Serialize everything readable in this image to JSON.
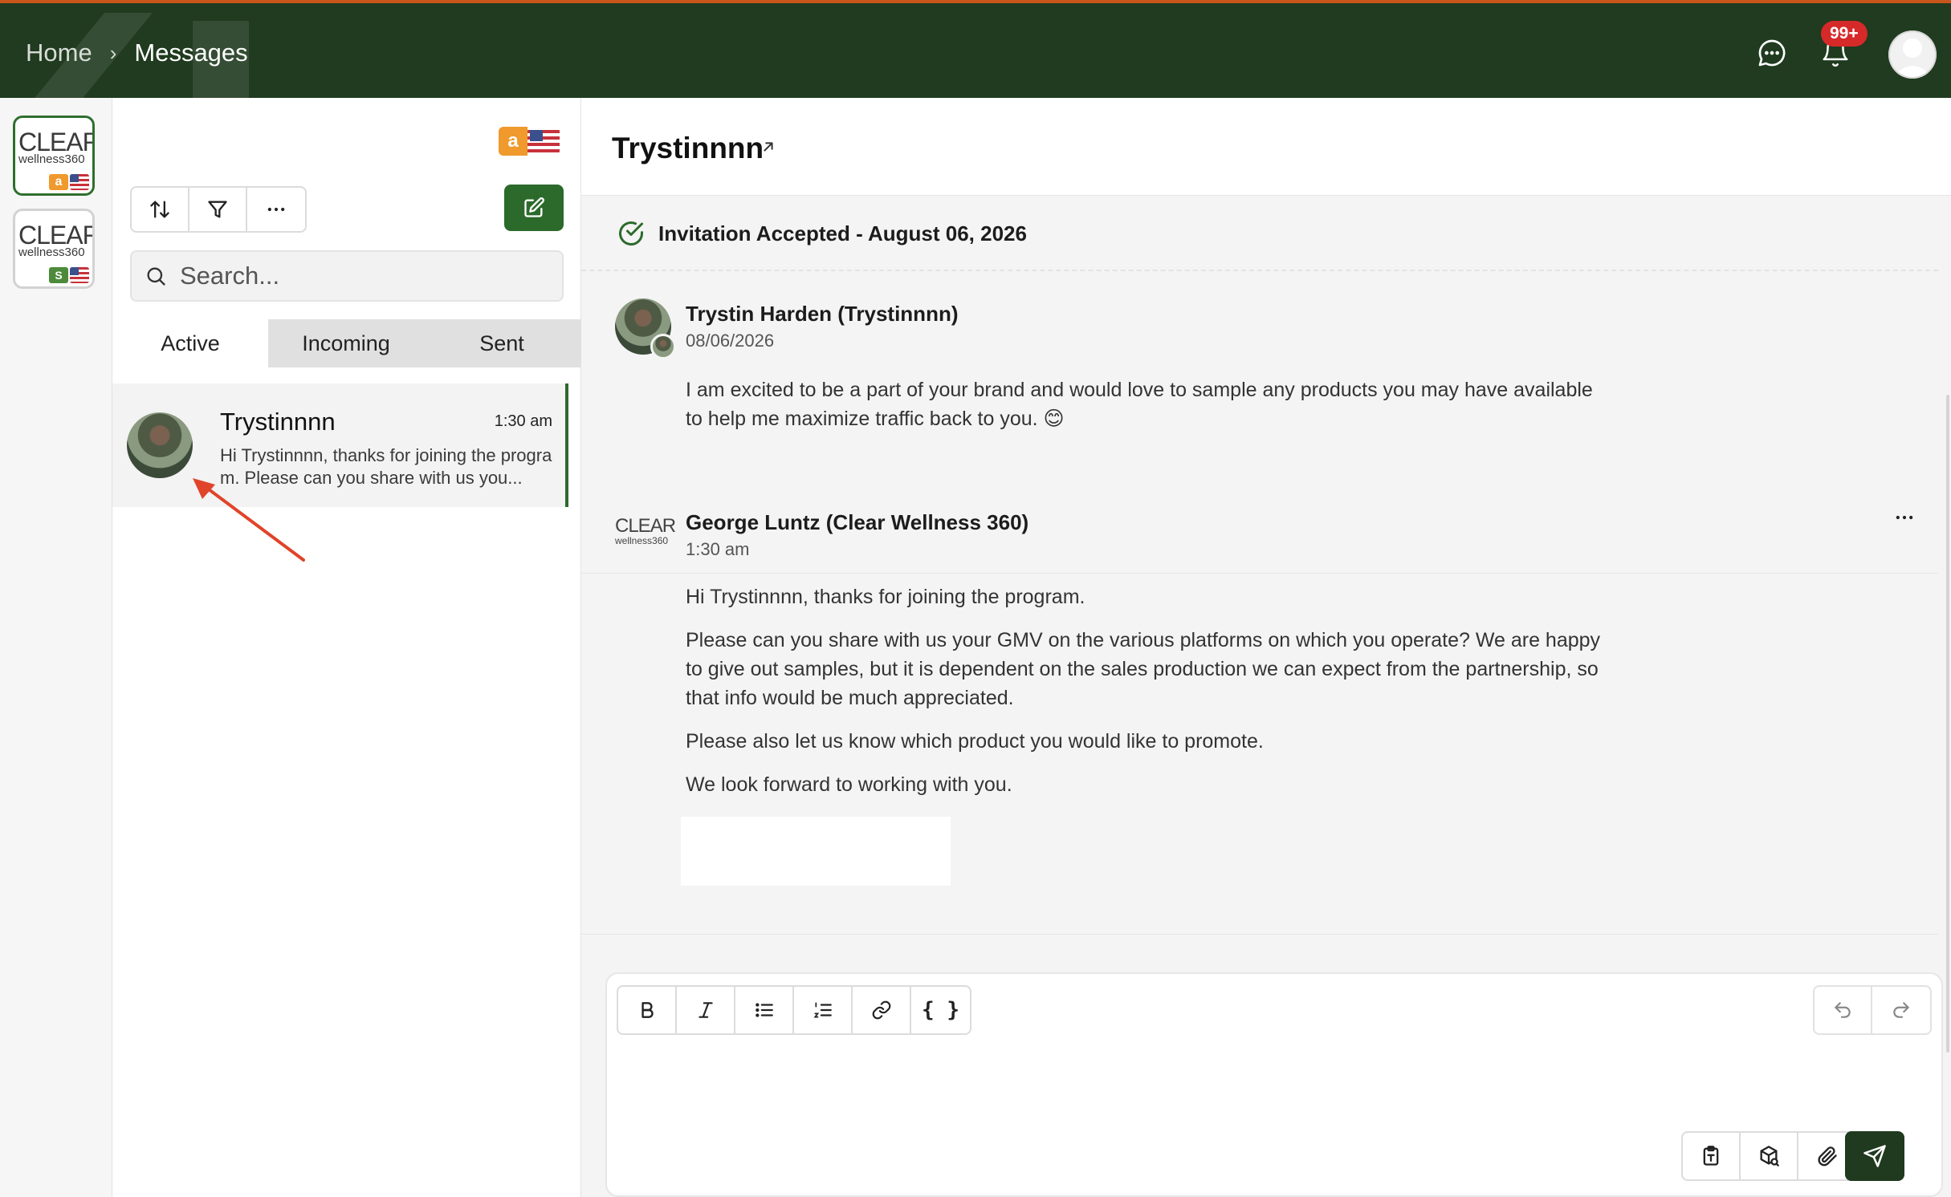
{
  "header": {
    "breadcrumb": [
      {
        "label": "Home"
      },
      {
        "label": "Messages"
      }
    ],
    "notification_count": "99+",
    "icons": [
      "chat-bubble-icon",
      "bell-icon",
      "user-avatar"
    ]
  },
  "brand_rail": {
    "brands": [
      {
        "name_line1": "CLEAR",
        "name_line2": "wellness360",
        "marketplace_icon": "amazon-icon",
        "flag": "us-flag-icon",
        "active": true
      },
      {
        "name_line1": "CLEAR",
        "name_line2": "wellness360",
        "marketplace_icon": "shopify-icon",
        "flag": "us-flag-icon",
        "active": false
      }
    ]
  },
  "list_panel": {
    "marketplace_badge": {
      "letter": "a",
      "flag": "us-flag-icon"
    },
    "toolbar_icons": [
      "sort-icon",
      "filter-icon",
      "more-horizontal-icon"
    ],
    "compose_icon": "compose-icon",
    "search": {
      "placeholder": "Search...",
      "value": ""
    },
    "tabs": [
      {
        "label": "Active",
        "active": true
      },
      {
        "label": "Incoming",
        "active": false
      },
      {
        "label": "Sent",
        "active": false
      }
    ],
    "conversations": [
      {
        "name": "Trystinnnn",
        "time": "1:30 am",
        "preview": "Hi Trystinnnn, thanks for joining the program. Please can you share with us you..."
      }
    ]
  },
  "chat": {
    "title": "Trystinnnn",
    "invitation": "Invitation Accepted - August 06, 2026",
    "messages": [
      {
        "sender": "Trystin Harden (Trystinnnn)",
        "time": "08/06/2026",
        "paragraphs": [
          "I am excited to be a part of your brand and would love to sample any products you may have available to help me maximize traffic back to you. 😊"
        ]
      },
      {
        "sender": "George Luntz (Clear Wellness 360)",
        "time": "1:30 am",
        "logo_line1": "CLEAR",
        "logo_line2": "wellness360",
        "paragraphs": [
          "Hi Trystinnnn, thanks for joining the program.",
          "Please can you share with us your GMV on the various platforms on which you operate? We are happy to give out samples, but it is dependent on the sales production we can expect from the partnership, so that info would be much appreciated.",
          "Please also let us know which product you would like to promote.",
          "We look forward to working with you."
        ]
      }
    ]
  },
  "composer": {
    "format_buttons": [
      {
        "label": "B",
        "icon": "bold-icon"
      },
      {
        "label": "I",
        "icon": "italic-icon"
      },
      {
        "label": "",
        "icon": "bullet-list-icon"
      },
      {
        "label": "",
        "icon": "numbered-list-icon"
      },
      {
        "label": "",
        "icon": "link-icon"
      },
      {
        "label": "{ }",
        "icon": "code-braces-icon"
      }
    ],
    "history_icons": [
      "undo-icon",
      "redo-icon"
    ],
    "action_icons": [
      "clipboard-icon",
      "product-box-icon",
      "paperclip-icon"
    ],
    "send_icon": "send-icon",
    "colors": {
      "primary_green": "#2c6a2b",
      "dark_green": "#1f3a1e",
      "topbar": "#203b1f",
      "accent_orange": "#c8561b",
      "badge_red": "#d62929"
    }
  }
}
